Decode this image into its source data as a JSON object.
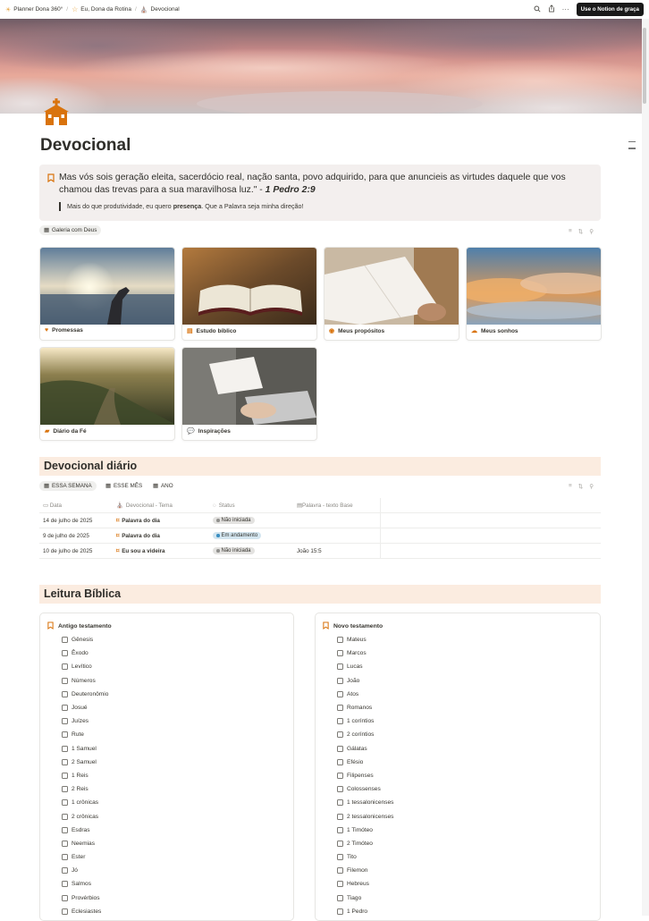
{
  "breadcrumbs": [
    {
      "label": "Planner Dona 360°",
      "icon": "sun-icon"
    },
    {
      "label": "Eu, Dona da Rotina",
      "icon": "star-icon"
    },
    {
      "label": "Devocional",
      "icon": "church-icon"
    }
  ],
  "topbar": {
    "cta_label": "Use o Notion de graça",
    "search_icon": "search-icon",
    "share_icon": "share-icon",
    "more_icon": "more-icon"
  },
  "page": {
    "title": "Devocional",
    "icon": "church-icon"
  },
  "callout": {
    "verse": "Mas vós sois geração eleita, sacerdócio real, nação santa, povo adquirido, para que anuncieis as virtudes daquele que vos chamou das trevas para a sua maravilhosa luz.\" -",
    "reference": "1 Pedro 2:9",
    "quote_prefix": "Mais do que produtividade, eu quero ",
    "quote_bold": "presença",
    "quote_suffix": ". Que a Palavra seja minha direção!"
  },
  "gallery": {
    "view_label": "Galeria com Deus",
    "cards": [
      {
        "label": "Promessas",
        "icon_color": "#d9730d"
      },
      {
        "label": "Estudo bíblico",
        "icon_color": "#d9730d"
      },
      {
        "label": "Meus propósitos",
        "icon_color": "#d9730d"
      },
      {
        "label": "Meus sonhos",
        "icon_color": "#d9730d"
      },
      {
        "label": "Diário da Fé",
        "icon_color": "#d9730d"
      },
      {
        "label": "Inspirações",
        "icon_color": "#d9730d"
      }
    ]
  },
  "devocional": {
    "heading": "Devocional diário",
    "tabs": [
      "ESSA SEMANA",
      "ESSE MÊS",
      "ANO"
    ],
    "columns": [
      "Data",
      "Devocional - Tema",
      "Status",
      "Palavra - texto Base"
    ],
    "rows": [
      {
        "date": "14 de julho de 2025",
        "tema": "Palavra do dia",
        "status": "Não iniciada",
        "status_color": "#e3e2e0",
        "texto": ""
      },
      {
        "date": "9 de julho de 2025",
        "tema": "Palavra do dia",
        "status": "Em andamento",
        "status_color": "#d3e5ef",
        "texto": ""
      },
      {
        "date": "10 de julho de 2025",
        "tema": "Eu sou a videira",
        "status": "Não iniciada",
        "status_color": "#e3e2e0",
        "texto": "João 15:5"
      }
    ]
  },
  "leitura": {
    "heading": "Leitura Bíblica",
    "antigo": {
      "title": "Antigo testamento",
      "books": [
        "Gênesis",
        "Êxodo",
        "Levítico",
        "Números",
        "Deuteronômio",
        "Josué",
        "Juízes",
        "Rute",
        "1 Samuel",
        "2 Samuel",
        "1 Reis",
        "2 Reis",
        "1 crônicas",
        "2 crônicas",
        "Esdras",
        "Neemias",
        "Ester",
        "Jó",
        "Salmos",
        "Provérbios",
        "Eclesiastes"
      ]
    },
    "novo": {
      "title": "Novo testamento",
      "books": [
        "Mateus",
        "Marcos",
        "Lucas",
        "João",
        "Atos",
        "Romanos",
        "1 coríntios",
        "2 coríntios",
        "Gálatas",
        "Efésio",
        "Filipenses",
        "Colossenses",
        "1 tessalonicenses",
        "2 tessalonicenses",
        "1 Timóteo",
        "2 Timóteo",
        "Tito",
        "Filemon",
        "Hebreus",
        "Tiago",
        "1 Pedro"
      ]
    }
  }
}
